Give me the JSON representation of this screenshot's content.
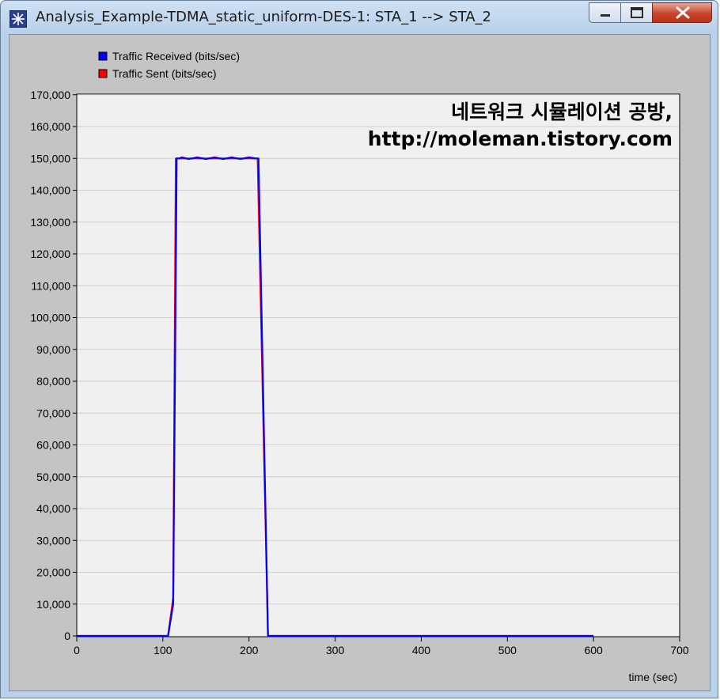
{
  "window": {
    "title": "Analysis_Example-TDMA_static_uniform-DES-1: STA_1 --> STA_2",
    "icons": [
      "app-star-icon",
      "minimize-icon",
      "maximize-icon",
      "close-icon"
    ]
  },
  "overlay": {
    "line1": "네트워크 시뮬레이션 공방,",
    "line2": "http://moleman.tistory.com"
  },
  "chart_data": {
    "type": "line",
    "xlabel": "time (sec)",
    "ylabel": "",
    "xlim": [
      0,
      700
    ],
    "ylim": [
      0,
      170000
    ],
    "x_ticks": [
      0,
      100,
      200,
      300,
      400,
      500,
      600,
      700
    ],
    "x_tick_labels": [
      "0",
      "100",
      "200",
      "300",
      "400",
      "500",
      "600",
      "700"
    ],
    "y_ticks": [
      0,
      10000,
      20000,
      30000,
      40000,
      50000,
      60000,
      70000,
      80000,
      90000,
      100000,
      110000,
      120000,
      130000,
      140000,
      150000,
      160000,
      170000
    ],
    "y_tick_labels": [
      "0",
      "10,000",
      "20,000",
      "30,000",
      "40,000",
      "50,000",
      "60,000",
      "70,000",
      "80,000",
      "90,000",
      "100,000",
      "110,000",
      "120,000",
      "130,000",
      "140,000",
      "150,000",
      "160,000",
      "170,000"
    ],
    "grid": true,
    "legend_position": "top-left",
    "series": [
      {
        "name": "Traffic Received (bits/sec)",
        "color": "#0000ff",
        "x": [
          0,
          106,
          112,
          116,
          119,
          122,
          130,
          140,
          150,
          160,
          170,
          180,
          190,
          200,
          208,
          211,
          222,
          228,
          600
        ],
        "y": [
          0,
          0,
          10000,
          150000,
          150000,
          150300,
          149800,
          150300,
          149800,
          150300,
          149800,
          150300,
          149800,
          150300,
          150000,
          150000,
          0,
          0,
          0
        ]
      },
      {
        "name": "Traffic Sent (bits/sec)",
        "color": "#ff0000",
        "x": [
          0,
          106,
          112,
          115,
          118,
          130,
          150,
          170,
          190,
          210,
          222,
          228,
          600
        ],
        "y": [
          0,
          0,
          12000,
          150000,
          150000,
          150000,
          150000,
          150000,
          150000,
          150000,
          0,
          0,
          0
        ]
      }
    ]
  }
}
